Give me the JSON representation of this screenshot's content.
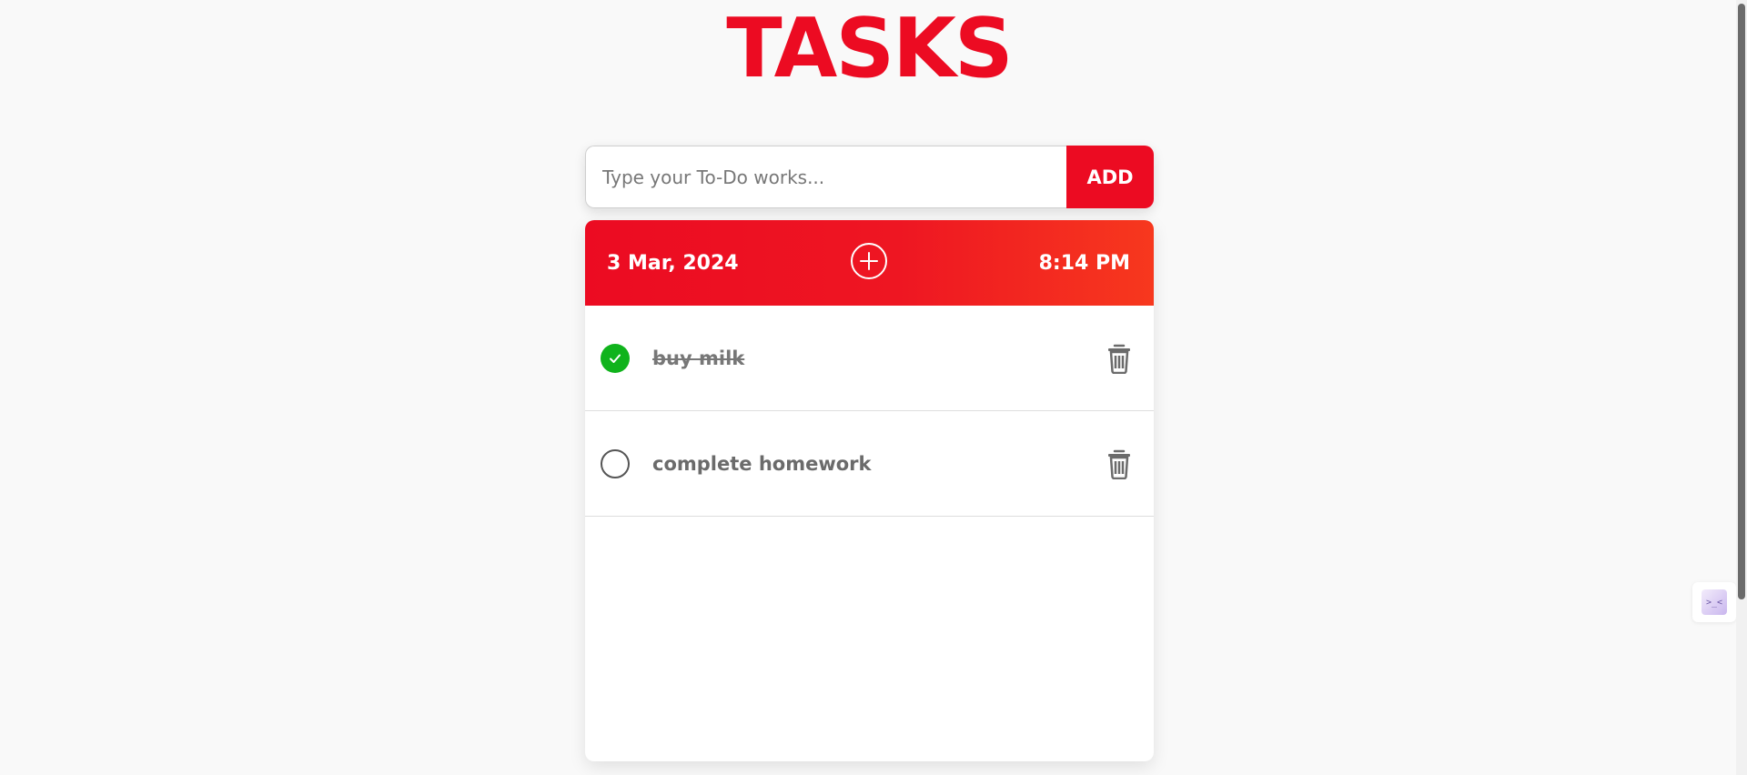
{
  "app": {
    "title": "TASKS"
  },
  "form": {
    "input_placeholder": "Type your To-Do works...",
    "input_value": "",
    "add_label": "ADD"
  },
  "header": {
    "date": "3 Mar, 2024",
    "time": "8:14 PM",
    "add_icon": "plus-circle-icon"
  },
  "tasks": [
    {
      "text": "buy milk",
      "completed": true
    },
    {
      "text": "complete homework",
      "completed": false
    }
  ],
  "colors": {
    "accent": "#ec0b22",
    "accent_end": "#f7381e",
    "done_green": "#10b31c",
    "background": "#f9f9f9"
  },
  "widget": {
    "glyph": ">_<"
  }
}
